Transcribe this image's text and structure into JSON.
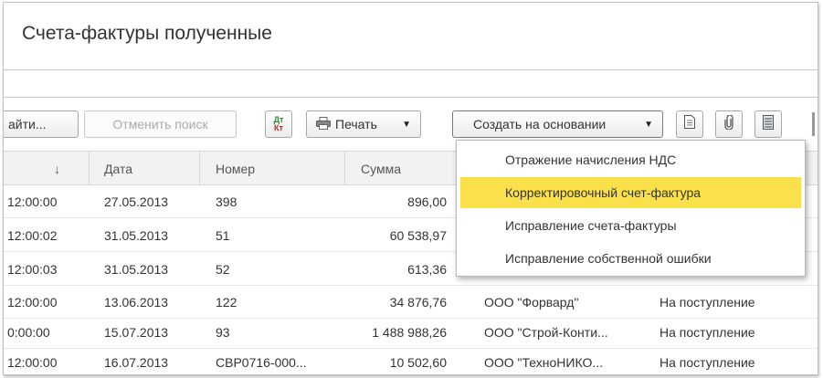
{
  "page": {
    "title": "Счета-фактуры полученные"
  },
  "toolbar": {
    "find_label": "айти...",
    "cancel_search_label": "Отменить поиск",
    "dtkt_top": "Дт",
    "dtkt_bottom": "Кт",
    "print_label": "Печать",
    "create_based_label": "Создать на основании"
  },
  "table": {
    "columns": [
      "↓",
      "Дата",
      "Номер",
      "Сумма"
    ],
    "rows": [
      {
        "time": "12:00:00",
        "date": "27.05.2013",
        "number": "398",
        "sum": "896,00",
        "counterparty": "",
        "status": ""
      },
      {
        "time": "12:00:02",
        "date": "31.05.2013",
        "number": "51",
        "sum": "60 538,97",
        "counterparty": "",
        "status": ""
      },
      {
        "time": "12:00:03",
        "date": "31.05.2013",
        "number": "52",
        "sum": "613,36",
        "counterparty": "",
        "status": ""
      },
      {
        "time": "12:00:00",
        "date": "13.06.2013",
        "number": "122",
        "sum": "34 876,76",
        "counterparty": "ООО \"Форвард\"",
        "status": "На поступление"
      },
      {
        "time": "0:00:00",
        "date": "15.07.2013",
        "number": "93",
        "sum": "1 488 988,26",
        "counterparty": "ООО \"Строй-Конти...",
        "status": "На поступление"
      },
      {
        "time": "12:00:00",
        "date": "16.07.2013",
        "number": "СВР0716-000...",
        "sum": "10 502,60",
        "counterparty": "ООО \"ТехноНИКО...",
        "status": "На поступление"
      }
    ]
  },
  "dropdown": {
    "items": [
      {
        "label": "Отражение начисления НДС",
        "active": false
      },
      {
        "label": "Корректировочный счет-фактура",
        "active": true
      },
      {
        "label": "Исправление счета-фактуры",
        "active": false
      },
      {
        "label": "Исправление собственной ошибки",
        "active": false
      }
    ]
  },
  "colors": {
    "highlight": "#fae04a",
    "header_bg": "#f2f2f2",
    "dtkt_green": "#2e8b2e",
    "dtkt_red": "#cc2222"
  }
}
